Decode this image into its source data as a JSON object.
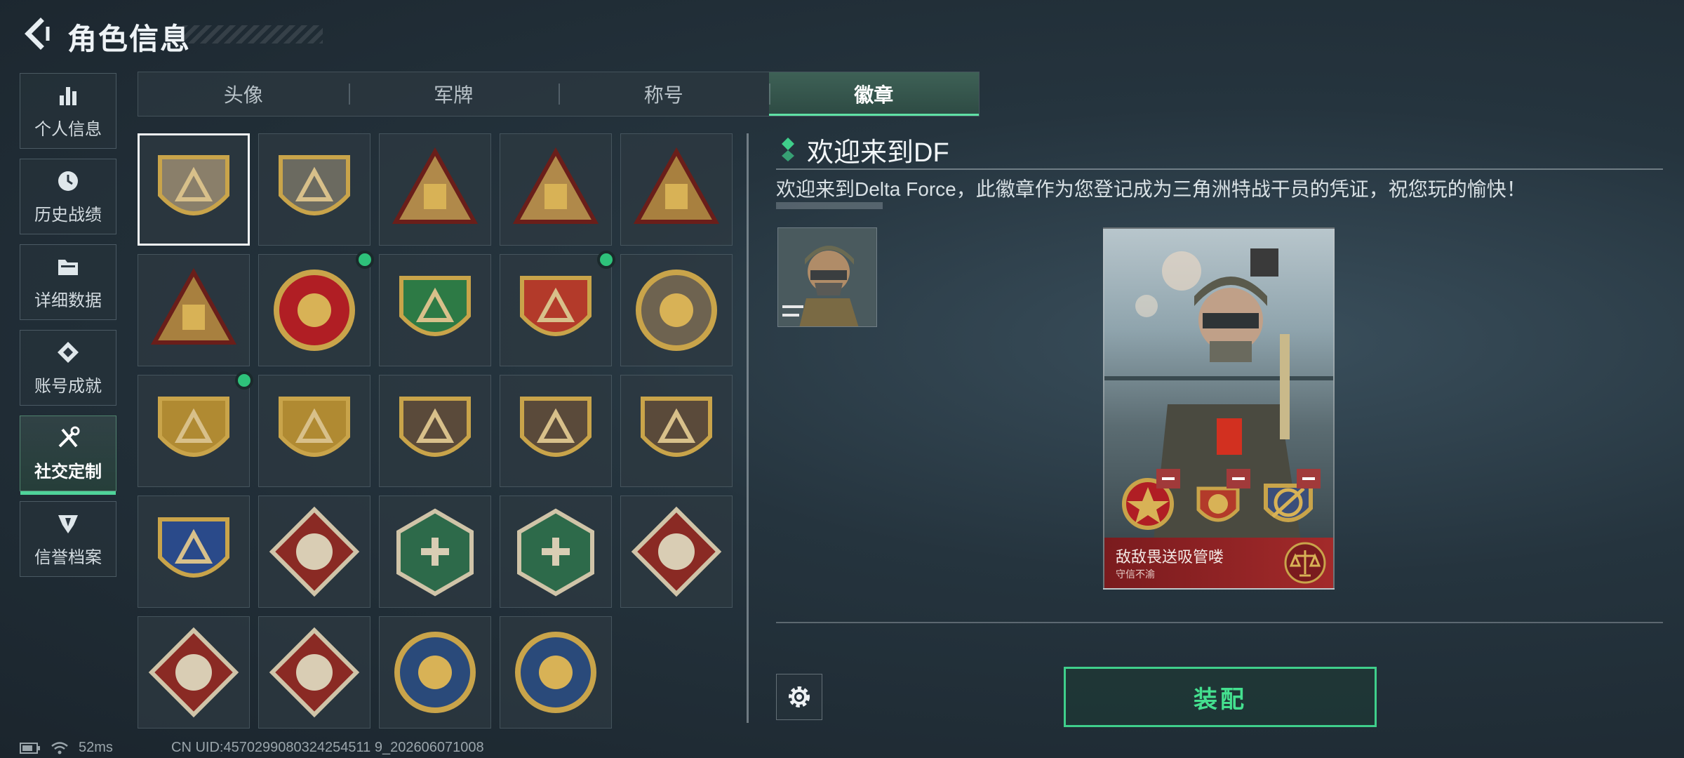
{
  "header": {
    "title": "角色信息",
    "back_icon": "chevron-left-icon"
  },
  "nav": {
    "items": [
      {
        "label": "个人信息",
        "icon": "bar-chart-icon",
        "active": false
      },
      {
        "label": "历史战绩",
        "icon": "clock-icon",
        "active": false
      },
      {
        "label": "详细数据",
        "icon": "folder-icon",
        "active": false
      },
      {
        "label": "账号成就",
        "icon": "achievement-icon",
        "active": false
      },
      {
        "label": "社交定制",
        "icon": "tools-icon",
        "active": true
      },
      {
        "label": "信誉档案",
        "icon": "shield-icon",
        "active": false
      }
    ]
  },
  "tabs": [
    {
      "label": "头像",
      "active": false
    },
    {
      "label": "军牌",
      "active": false
    },
    {
      "label": "称号",
      "active": false
    },
    {
      "label": "徽章",
      "active": true
    }
  ],
  "badges": [
    {
      "id": "welcome-df",
      "selected": true,
      "new": false,
      "color": "#8a7f6a"
    },
    {
      "id": "helicopter",
      "selected": false,
      "new": false,
      "color": "#6b6a60"
    },
    {
      "id": "tower",
      "selected": false,
      "new": false,
      "color": "#b0894a"
    },
    {
      "id": "cloud",
      "selected": false,
      "new": false,
      "color": "#b0894a"
    },
    {
      "id": "number-one",
      "selected": false,
      "new": false,
      "color": "#a8803f"
    },
    {
      "id": "soldiers",
      "selected": false,
      "new": false,
      "color": "#a8803f"
    },
    {
      "id": "star-circle",
      "selected": false,
      "new": true,
      "color": "#b01e24"
    },
    {
      "id": "green-shield",
      "selected": false,
      "new": false,
      "color": "#2d7a45"
    },
    {
      "id": "laurel-shield",
      "selected": false,
      "new": true,
      "color": "#b33a2a"
    },
    {
      "id": "skull-wings",
      "selected": false,
      "new": false,
      "color": "#6e6350"
    },
    {
      "id": "sniper-gold-1",
      "selected": false,
      "new": true,
      "color": "#b08a32"
    },
    {
      "id": "sniper-gold-2",
      "selected": false,
      "new": false,
      "color": "#b08a32"
    },
    {
      "id": "shotgun",
      "selected": false,
      "new": false,
      "color": "#5a4a3a"
    },
    {
      "id": "rifle",
      "selected": false,
      "new": false,
      "color": "#5a4a3a"
    },
    {
      "id": "pistol",
      "selected": false,
      "new": false,
      "color": "#5a4a3a"
    },
    {
      "id": "blue-crosshair",
      "selected": false,
      "new": false,
      "color": "#2a4a8a"
    },
    {
      "id": "wolf",
      "selected": false,
      "new": false,
      "color": "#8a2a24"
    },
    {
      "id": "hornet",
      "selected": false,
      "new": false,
      "color": "#2d6a4a"
    },
    {
      "id": "medic-gun",
      "selected": false,
      "new": false,
      "color": "#2d6a4a"
    },
    {
      "id": "dragon-1",
      "selected": false,
      "new": false,
      "color": "#8a2a24"
    },
    {
      "id": "dragon-2",
      "selected": false,
      "new": false,
      "color": "#8a2a24"
    },
    {
      "id": "runner",
      "selected": false,
      "new": false,
      "color": "#8a2a24"
    },
    {
      "id": "lynx-1",
      "selected": false,
      "new": false,
      "color": "#2a4a7a"
    },
    {
      "id": "lynx-2",
      "selected": false,
      "new": false,
      "color": "#2a4a7a"
    }
  ],
  "detail": {
    "title": "欢迎来到DF",
    "description": "欢迎来到Delta Force，此徽章作为您登记成为三角洲特战干员的凭证，祝您玩的愉快！"
  },
  "card": {
    "name": "敌敌畏送吸管喽",
    "subtitle": "守信不渝"
  },
  "actions": {
    "equip_label": "装配",
    "settings_icon": "gear-icon"
  },
  "status": {
    "ping": "52ms",
    "uid": "CN UID:4570299080324254511 9_202606071008"
  },
  "colors": {
    "accent": "#44e08f",
    "new_dot": "#2ec27a",
    "card_red": "#a32a2a"
  }
}
